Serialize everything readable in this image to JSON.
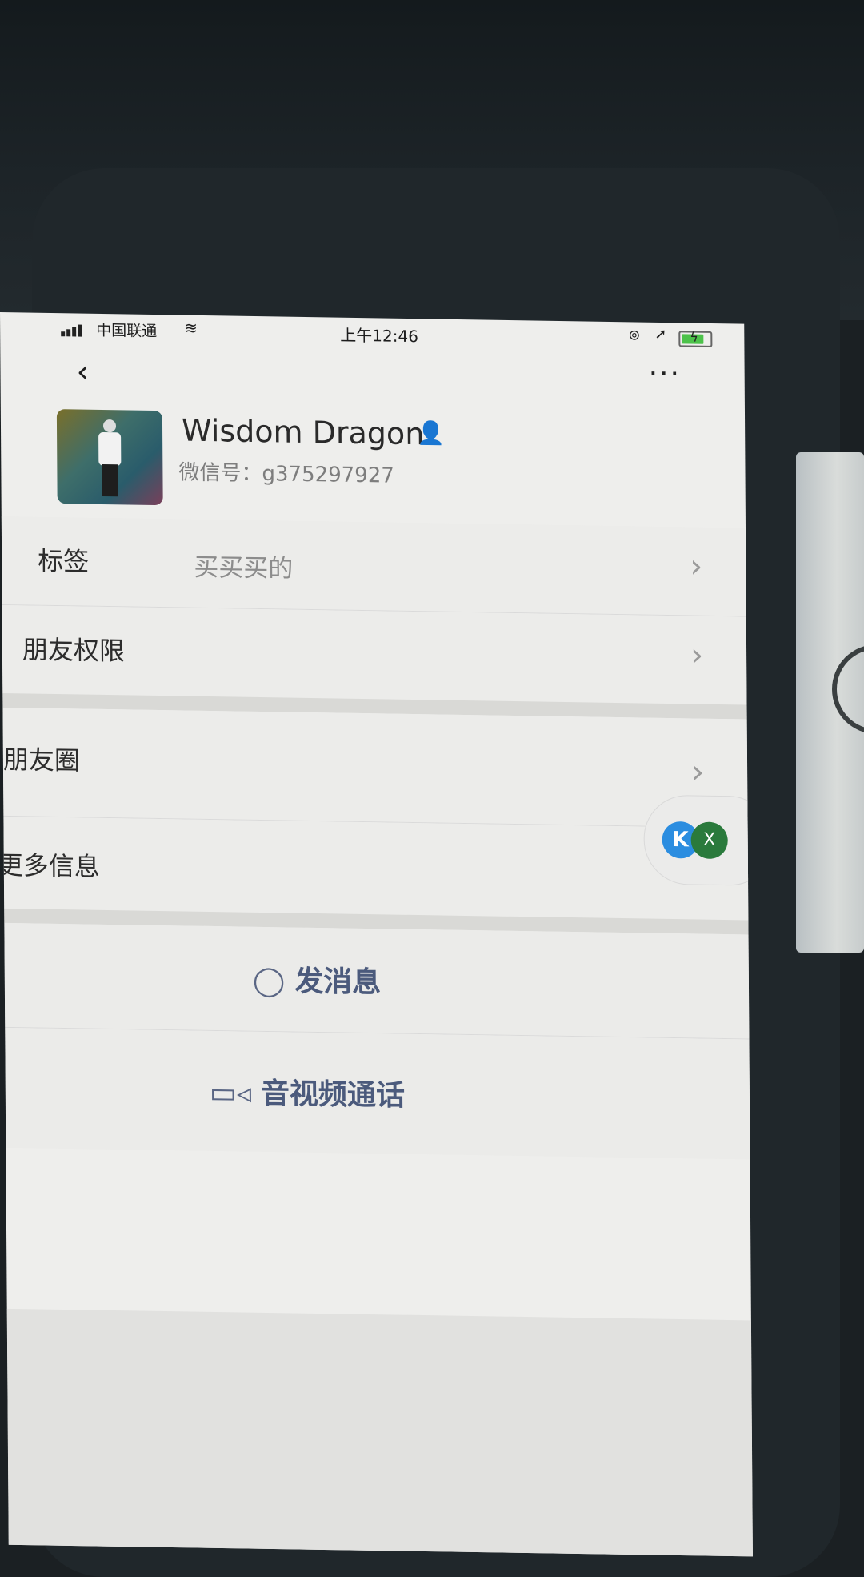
{
  "status_bar": {
    "carrier": "中国联通",
    "time": "上午12:46"
  },
  "profile": {
    "name": "Wisdom Dragon",
    "wechat_id": "微信号：g375297927"
  },
  "rows": {
    "tags": {
      "label": "标签",
      "value": "买买买的"
    },
    "friend_permissions": {
      "label": "朋友权限"
    },
    "moments": {
      "label": "朋友圈"
    },
    "more_info": {
      "label": "更多信息"
    }
  },
  "actions": {
    "send_message": "发消息",
    "av_call": "音视频通话"
  },
  "floating": {
    "k_label": "K",
    "close_label": "X"
  },
  "icons": {
    "back": "chevron-left",
    "more": "ellipsis",
    "chat": "chat-bubble",
    "video": "video-camera",
    "verified": "person"
  },
  "colors": {
    "accent_blue": "#2f7bd1",
    "action_text": "#4b5a7c",
    "battery_green": "#4cc24a"
  }
}
